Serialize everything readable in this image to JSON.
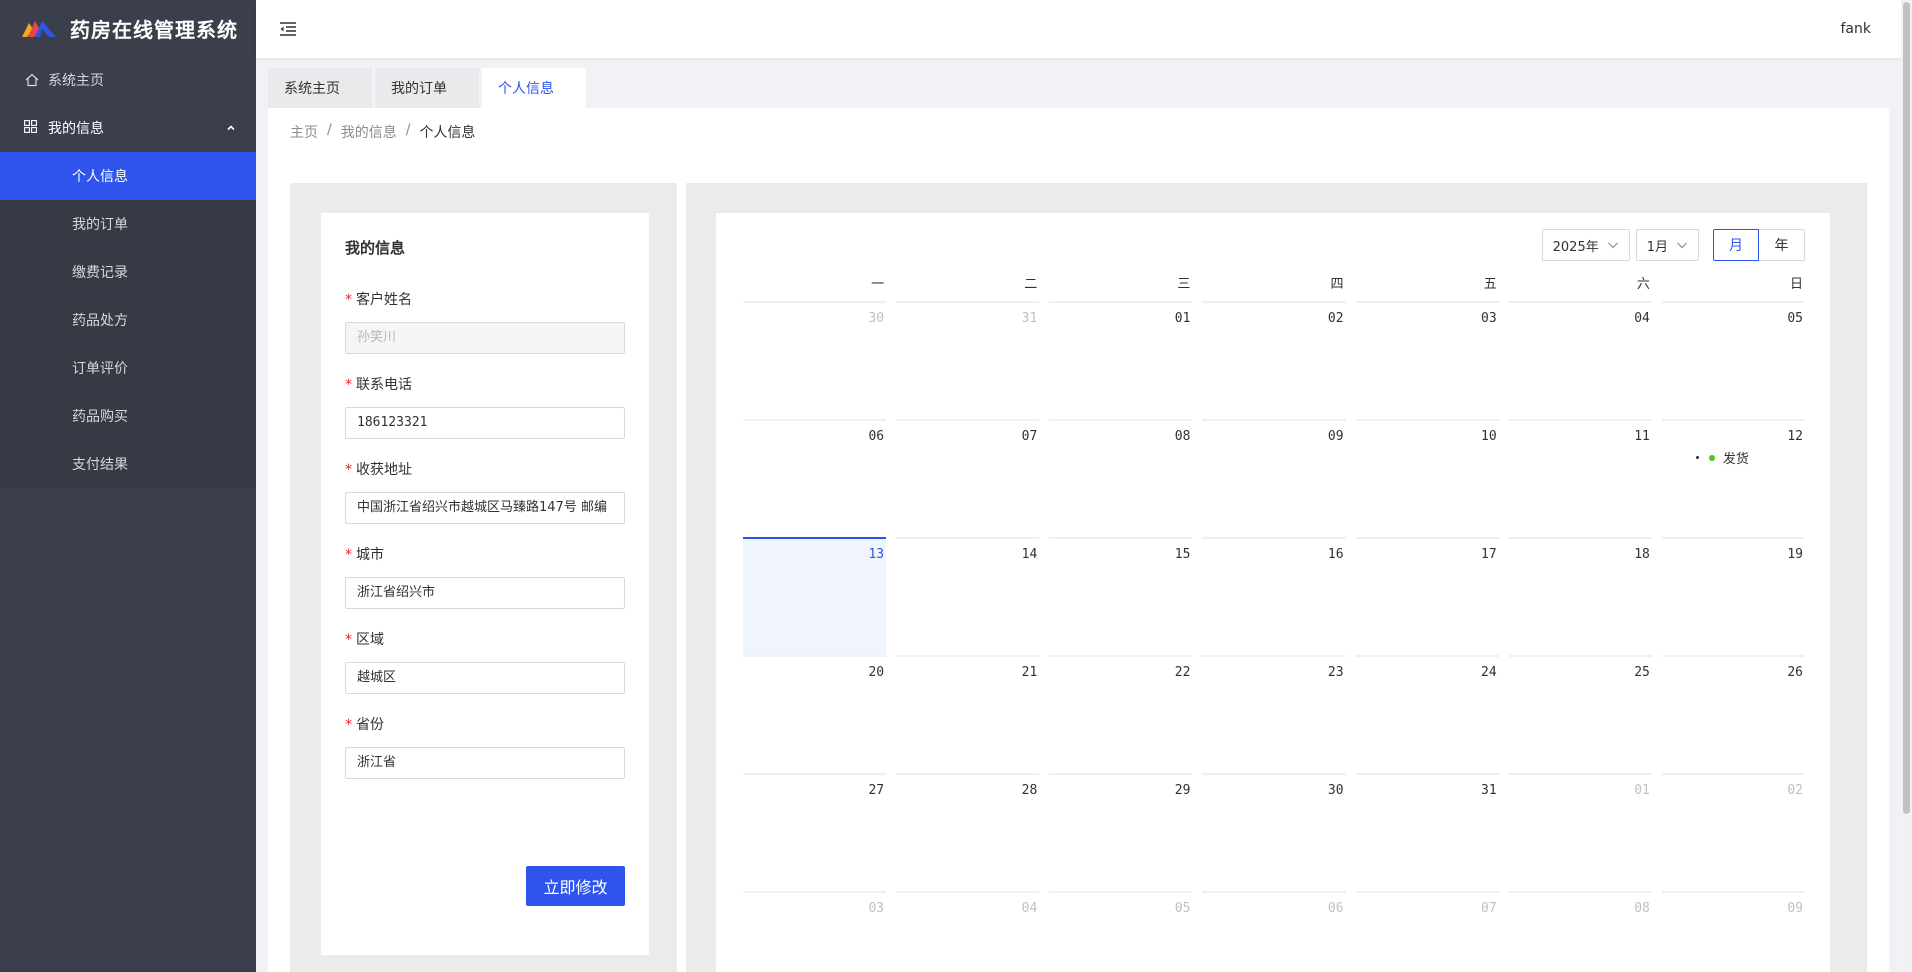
{
  "app": {
    "title": "药房在线管理系统",
    "user": "fank"
  },
  "sidebar": {
    "home": "系统主页",
    "group": "我的信息",
    "items": [
      {
        "label": "个人信息",
        "active": true
      },
      {
        "label": "我的订单",
        "active": false
      },
      {
        "label": "缴费记录",
        "active": false
      },
      {
        "label": "药品处方",
        "active": false
      },
      {
        "label": "订单评价",
        "active": false
      },
      {
        "label": "药品购买",
        "active": false
      },
      {
        "label": "支付结果",
        "active": false
      }
    ]
  },
  "tabs": [
    {
      "label": "系统主页",
      "active": false
    },
    {
      "label": "我的订单",
      "active": false
    },
    {
      "label": "个人信息",
      "active": true
    }
  ],
  "breadcrumb": [
    "主页",
    "我的信息",
    "个人信息"
  ],
  "form": {
    "title": "我的信息",
    "fields": [
      {
        "label": "客户姓名",
        "value": "孙笑川",
        "disabled": true,
        "cjk": true
      },
      {
        "label": "联系电话",
        "value": "186123321",
        "disabled": false,
        "cjk": false
      },
      {
        "label": "收获地址",
        "value": "中国浙江省绍兴市越城区马臻路147号 邮编",
        "disabled": false,
        "cjk": false
      },
      {
        "label": "城市",
        "value": "浙江省绍兴市",
        "disabled": false,
        "cjk": true
      },
      {
        "label": "区域",
        "value": "越城区",
        "disabled": false,
        "cjk": true
      },
      {
        "label": "省份",
        "value": "浙江省",
        "disabled": false,
        "cjk": true
      }
    ],
    "submit": "立即修改"
  },
  "calendar": {
    "year_select": "2025年",
    "month_select": "1月",
    "mode_month": "月",
    "mode_year": "年",
    "weekdays": [
      "一",
      "二",
      "三",
      "四",
      "五",
      "六",
      "日"
    ],
    "days": [
      {
        "d": "30",
        "muted": true
      },
      {
        "d": "31",
        "muted": true
      },
      {
        "d": "01"
      },
      {
        "d": "02"
      },
      {
        "d": "03"
      },
      {
        "d": "04"
      },
      {
        "d": "05"
      },
      {
        "d": "06"
      },
      {
        "d": "07"
      },
      {
        "d": "08"
      },
      {
        "d": "09"
      },
      {
        "d": "10"
      },
      {
        "d": "11"
      },
      {
        "d": "12",
        "events": [
          {
            "text": "发货",
            "color": "#52c41a"
          }
        ]
      },
      {
        "d": "13",
        "today": true
      },
      {
        "d": "14"
      },
      {
        "d": "15"
      },
      {
        "d": "16"
      },
      {
        "d": "17"
      },
      {
        "d": "18"
      },
      {
        "d": "19"
      },
      {
        "d": "20"
      },
      {
        "d": "21"
      },
      {
        "d": "22"
      },
      {
        "d": "23"
      },
      {
        "d": "24"
      },
      {
        "d": "25"
      },
      {
        "d": "26"
      },
      {
        "d": "27"
      },
      {
        "d": "28"
      },
      {
        "d": "29"
      },
      {
        "d": "30"
      },
      {
        "d": "31"
      },
      {
        "d": "01",
        "muted": true
      },
      {
        "d": "02",
        "muted": true
      },
      {
        "d": "03",
        "muted": true
      },
      {
        "d": "04",
        "muted": true
      },
      {
        "d": "05",
        "muted": true
      },
      {
        "d": "06",
        "muted": true
      },
      {
        "d": "07",
        "muted": true
      },
      {
        "d": "08",
        "muted": true
      },
      {
        "d": "09",
        "muted": true
      }
    ]
  },
  "colors": {
    "primary": "#2f54eb",
    "sidebar_bg": "#3a3f4b",
    "required": "#f5222d",
    "event_green": "#52c41a"
  }
}
